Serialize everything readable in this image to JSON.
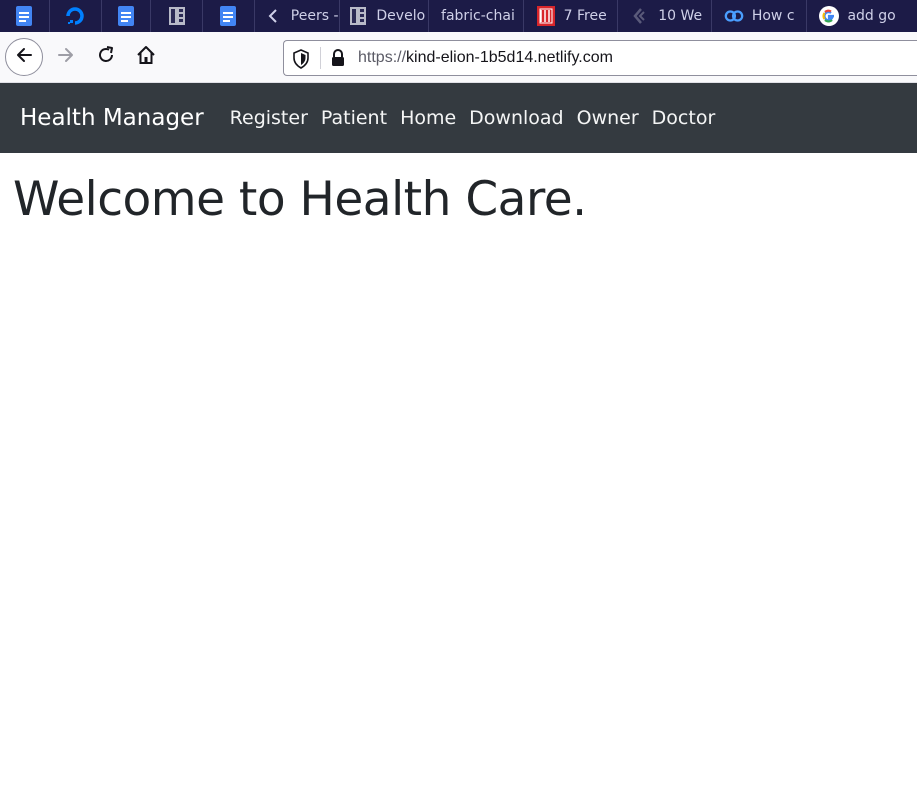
{
  "tabs": [
    {
      "icon": "google-docs-icon",
      "label": ""
    },
    {
      "icon": "digitalocean-icon",
      "label": ""
    },
    {
      "icon": "google-docs-icon",
      "label": ""
    },
    {
      "icon": "book-icon",
      "label": ""
    },
    {
      "icon": "google-docs-icon",
      "label": ""
    },
    {
      "icon": "chevron-left-icon",
      "label": "Peers -"
    },
    {
      "icon": "book-icon",
      "label": "Develo"
    },
    {
      "icon": "",
      "label": "fabric-chai"
    },
    {
      "icon": "red-pdf-icon",
      "label": "7 Free"
    },
    {
      "icon": "dev-icon",
      "label": "10 We"
    },
    {
      "icon": "loop-icon",
      "label": "How c"
    },
    {
      "icon": "google-icon",
      "label": "add go"
    }
  ],
  "browser": {
    "url_scheme": "https://",
    "url_host": "kind-elion-1b5d14.netlify.com"
  },
  "site": {
    "brand": "Health Manager",
    "nav_links": [
      "Register",
      "Patient",
      "Home",
      "Download",
      "Owner",
      "Doctor"
    ],
    "heading": "Welcome to Health Care."
  }
}
